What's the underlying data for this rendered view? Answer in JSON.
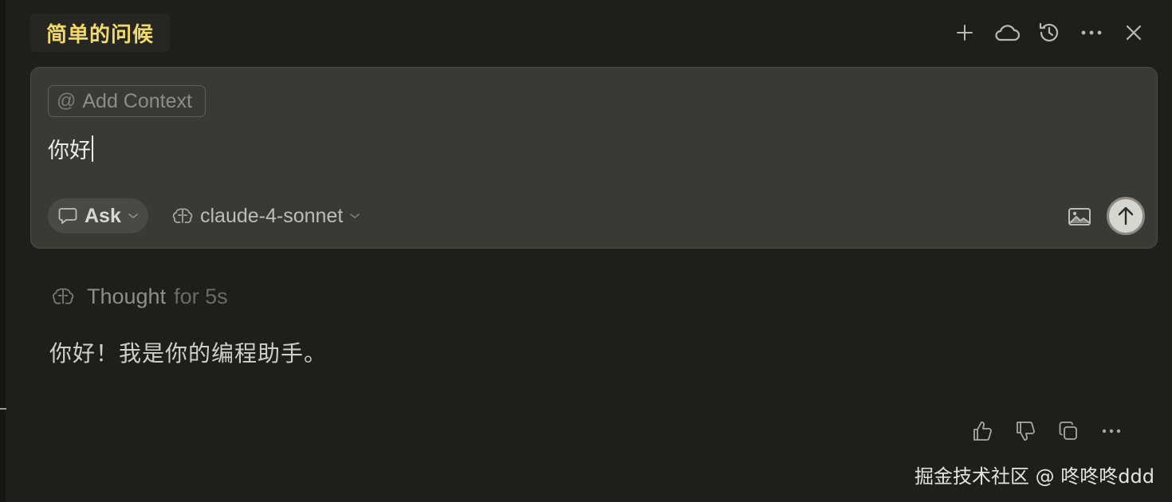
{
  "header": {
    "title": "简单的问候",
    "actions": [
      {
        "name": "new-chat",
        "icon": "plus-icon"
      },
      {
        "name": "sync",
        "icon": "cloud-icon"
      },
      {
        "name": "history",
        "icon": "history-icon"
      },
      {
        "name": "more",
        "icon": "more-horizontal-icon"
      },
      {
        "name": "close",
        "icon": "close-icon"
      }
    ]
  },
  "composer": {
    "add_context_label": "Add Context",
    "add_context_icon": "at-sign-icon",
    "input_value": "你好",
    "mode": {
      "label": "Ask",
      "icon": "chat-bubble-icon"
    },
    "model": {
      "label": "claude-4-sonnet",
      "icon": "brain-icon"
    },
    "image_icon": "image-icon",
    "send_icon": "arrow-up-icon"
  },
  "response": {
    "thought_label": "Thought",
    "thought_time": "for 5s",
    "text": "你好！我是你的编程助手。",
    "actions": [
      {
        "name": "thumbs-up",
        "icon": "thumbs-up-icon"
      },
      {
        "name": "thumbs-down",
        "icon": "thumbs-down-icon"
      },
      {
        "name": "copy",
        "icon": "copy-icon"
      },
      {
        "name": "more",
        "icon": "more-horizontal-icon"
      }
    ]
  },
  "watermark": "掘金技术社区 @ 咚咚咚ddd",
  "colors": {
    "background": "#1e1e1b",
    "composer_bg": "#3a3a35",
    "title_accent": "#f2d968",
    "send_button": "#d6d6cf"
  }
}
